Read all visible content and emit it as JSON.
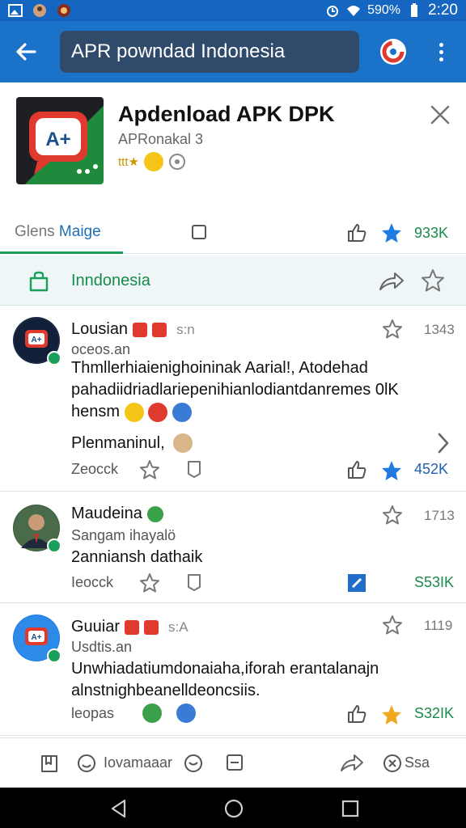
{
  "status_bar": {
    "battery": "590%",
    "time": "2:20"
  },
  "app_bar": {
    "search_value": "APR powndad Indonesia"
  },
  "app": {
    "title": "Apdenload APK DPK",
    "subtitle": "APRonakal 3",
    "rating_text": "ttt★"
  },
  "tabs": {
    "main_prefix": "Glens",
    "main_label": "Maige",
    "count": "933K"
  },
  "banner": {
    "label": "Inndonesia"
  },
  "posts": [
    {
      "name": "Lousian",
      "time": "s:n",
      "star_count": "1343",
      "handle": "oceos.an",
      "body": "Thmllerhiaienighoininak Aarial!, Atodehad pahadiidriadlariepenihianlodiantdanremes 0lK hensm",
      "subline": "Plenmaninul,",
      "action_label": "Zeocck",
      "action_count": "452K"
    },
    {
      "name": "Maudeina",
      "star_count": "1713",
      "handle": "Sangam ihayalö",
      "body": "2anniansh dathaik",
      "action_label": "Ieocck",
      "action_count": "S53IK"
    },
    {
      "name": "Guuiar",
      "time": "s:A",
      "star_count": "1119",
      "handle": "Usdtis.an",
      "body": "Unwhiadatiumdonaiaha,iforah erantalanajn alnstnighbeanelldeoncsiis.",
      "action_label": "leopas",
      "action_count": "S32IK"
    }
  ],
  "bottom_bar": {
    "label_left": "Iovamaaar",
    "label_right": "Ssa"
  },
  "colors": {
    "primary": "#1a73c8",
    "accent_green": "#1aa05a",
    "star_blue": "#1f7be0"
  }
}
